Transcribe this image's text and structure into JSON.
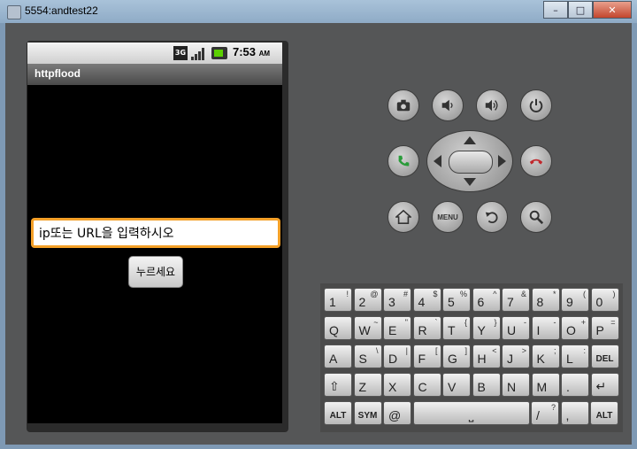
{
  "window": {
    "title": "5554:andtest22",
    "min": "–",
    "max": "□",
    "close": "✕"
  },
  "status": {
    "network": "3G",
    "time": "7:53",
    "ampm": "AM"
  },
  "app": {
    "title": "httpflood",
    "input_value": "ip또는 URL을 입력하시오",
    "button_label": "누르세요"
  },
  "controls": {
    "buttons": [
      "camera",
      "volume-down",
      "volume-up",
      "power",
      "call",
      "end-call",
      "home",
      "menu",
      "back",
      "search"
    ],
    "menu_label": "MENU"
  },
  "keyboard": {
    "row1": [
      [
        "1",
        "!"
      ],
      [
        "2",
        "@"
      ],
      [
        "3",
        "#"
      ],
      [
        "4",
        "$"
      ],
      [
        "5",
        "%"
      ],
      [
        "6",
        "^"
      ],
      [
        "7",
        "&"
      ],
      [
        "8",
        "*"
      ],
      [
        "9",
        "("
      ],
      [
        "0",
        ")"
      ]
    ],
    "row2": [
      [
        "Q",
        ""
      ],
      [
        "W",
        "~"
      ],
      [
        "E",
        "\""
      ],
      [
        "R",
        "`"
      ],
      [
        "T",
        "{"
      ],
      [
        "Y",
        "}"
      ],
      [
        "U",
        "-"
      ],
      [
        "I",
        "-"
      ],
      [
        "O",
        "+"
      ],
      [
        "P",
        "="
      ]
    ],
    "row3": [
      [
        "A",
        ""
      ],
      [
        "S",
        "\\"
      ],
      [
        "D",
        "|"
      ],
      [
        "F",
        "["
      ],
      [
        "G",
        "]"
      ],
      [
        "H",
        "<"
      ],
      [
        "J",
        ">"
      ],
      [
        "K",
        ";"
      ],
      [
        "L",
        ":"
      ],
      [
        "DEL",
        ""
      ]
    ],
    "row4": [
      [
        "⇧",
        ""
      ],
      [
        "Z",
        ""
      ],
      [
        "X",
        ""
      ],
      [
        "C",
        ""
      ],
      [
        "V",
        ""
      ],
      [
        "B",
        ""
      ],
      [
        "N",
        ""
      ],
      [
        "M",
        ""
      ],
      [
        ".",
        ""
      ],
      [
        "↵",
        ""
      ]
    ],
    "row5": [
      [
        "ALT",
        ""
      ],
      [
        "SYM",
        ""
      ],
      [
        "@",
        ""
      ],
      [
        "space",
        ""
      ],
      [
        "/",
        "?"
      ],
      [
        ",",
        ""
      ],
      [
        "ALT",
        ""
      ]
    ]
  }
}
